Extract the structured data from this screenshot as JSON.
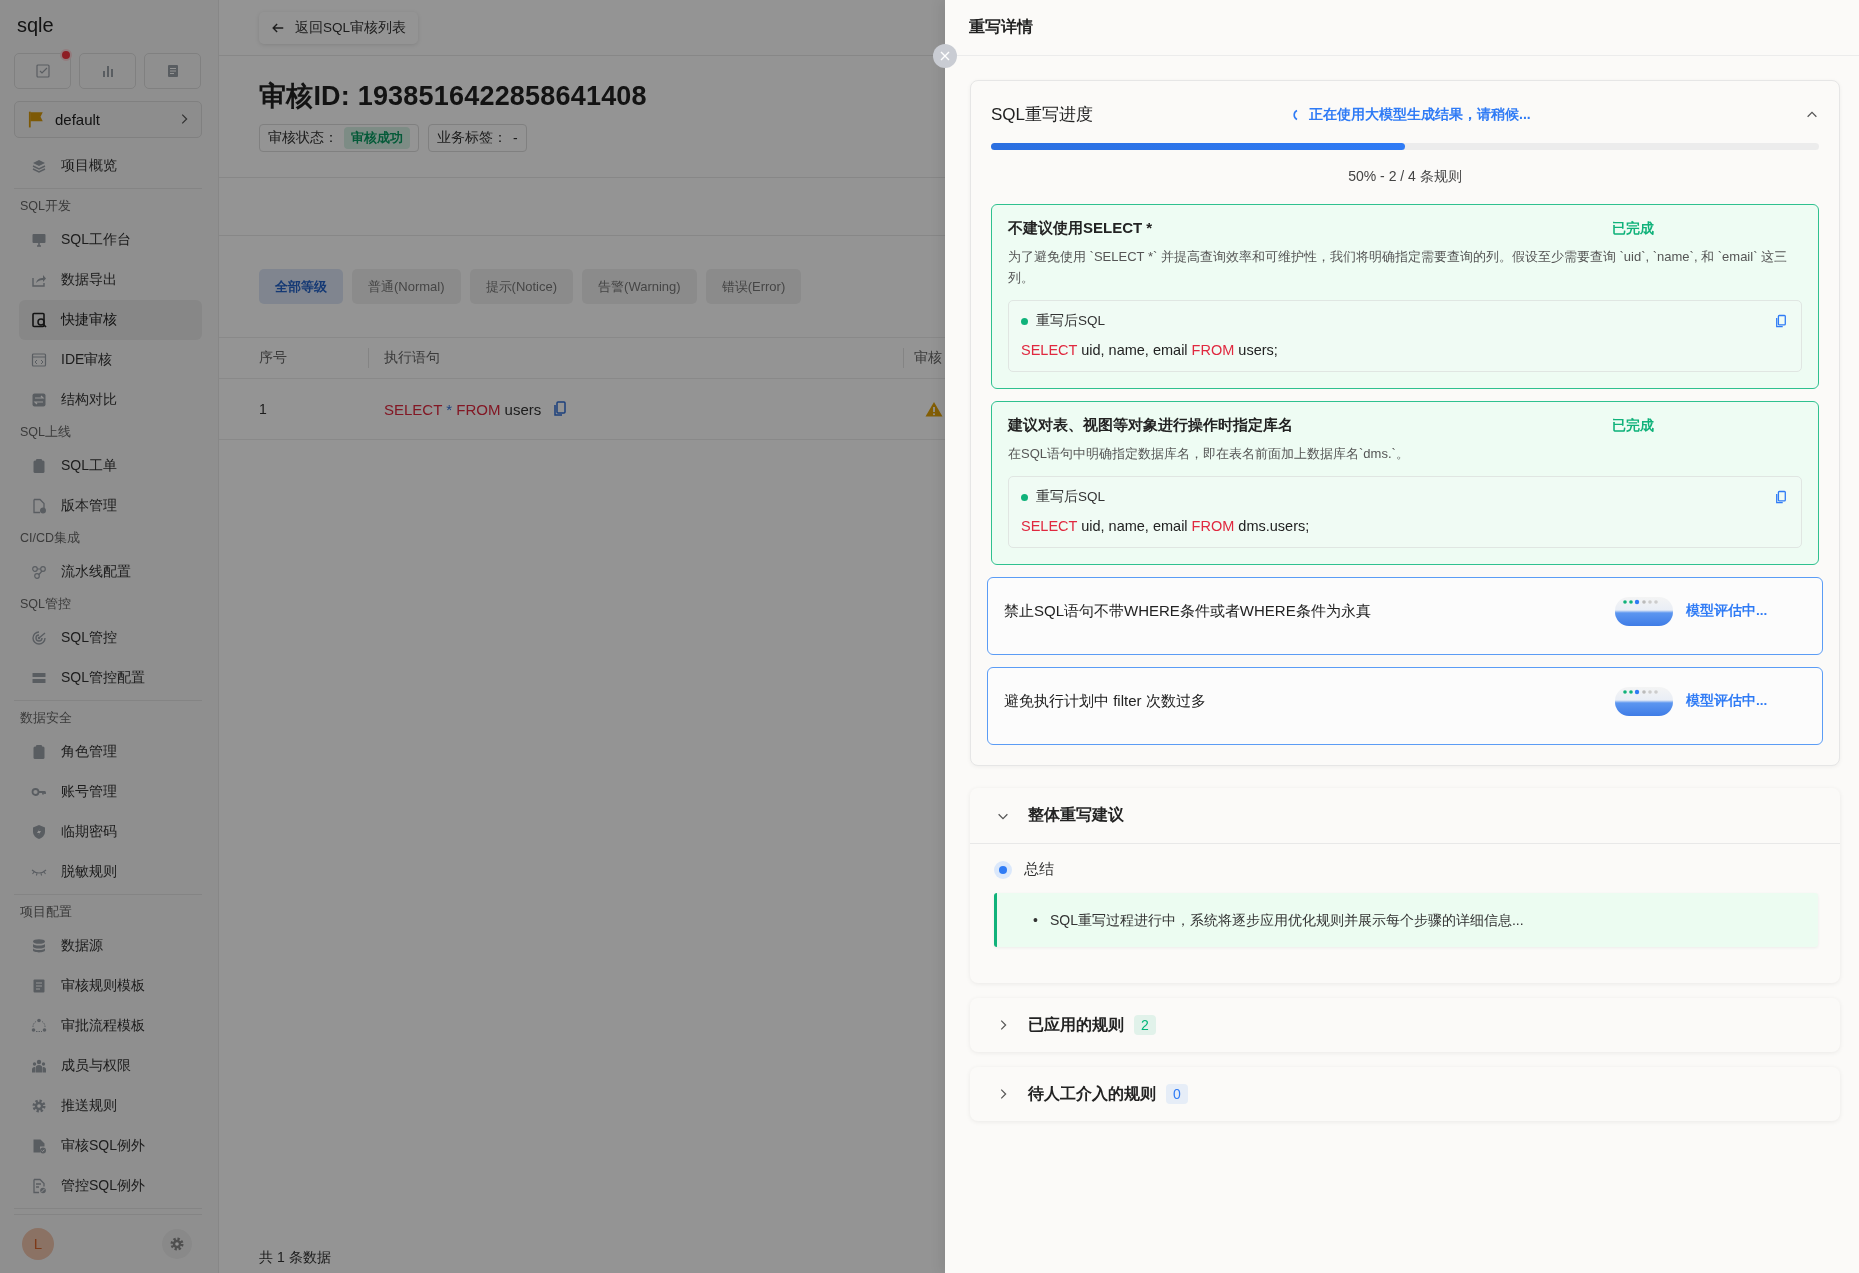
{
  "sidebar": {
    "logo": "sqle",
    "quick_actions": [
      {
        "badge": true
      },
      {
        "badge": false
      },
      {
        "badge": false
      }
    ],
    "project": "default",
    "groups": [
      {
        "items": [
          {
            "label": "项目概览",
            "selected": false
          }
        ],
        "divider_after": true
      },
      {
        "title": "SQL开发",
        "items": [
          {
            "label": "SQL工作台",
            "selected": false
          },
          {
            "label": "数据导出",
            "selected": false
          },
          {
            "label": "快捷审核",
            "selected": true
          },
          {
            "label": "IDE审核",
            "selected": false
          },
          {
            "label": "结构对比",
            "selected": false
          }
        ],
        "divider_after": false
      },
      {
        "title": "SQL上线",
        "items": [
          {
            "label": "SQL工单",
            "selected": false
          },
          {
            "label": "版本管理",
            "selected": false
          }
        ],
        "divider_after": false
      },
      {
        "title": "CI/CD集成",
        "items": [
          {
            "label": "流水线配置",
            "selected": false
          }
        ],
        "divider_after": false
      },
      {
        "title": "SQL管控",
        "items": [
          {
            "label": "SQL管控",
            "selected": false
          },
          {
            "label": "SQL管控配置",
            "selected": false
          }
        ],
        "divider_after": true
      },
      {
        "title": "数据安全",
        "items": [
          {
            "label": "角色管理",
            "selected": false
          },
          {
            "label": "账号管理",
            "selected": false
          },
          {
            "label": "临期密码",
            "selected": false
          },
          {
            "label": "脱敏规则",
            "selected": false
          }
        ],
        "divider_after": true
      },
      {
        "title": "项目配置",
        "items": [
          {
            "label": "数据源",
            "selected": false
          },
          {
            "label": "审核规则模板",
            "selected": false
          },
          {
            "label": "审批流程模板",
            "selected": false
          },
          {
            "label": "成员与权限",
            "selected": false
          },
          {
            "label": "推送规则",
            "selected": false
          },
          {
            "label": "审核SQL例外",
            "selected": false
          },
          {
            "label": "管控SQL例外",
            "selected": false
          }
        ],
        "divider_after": true
      }
    ],
    "user": {
      "avatar": "L"
    }
  },
  "main": {
    "back_button": "返回SQL审核列表",
    "title": "审核ID: 1938516422858641408",
    "status_label": "审核状态：",
    "status_tag": "审核成功",
    "business_label": "业务标签：",
    "business_value": "-",
    "filters": [
      {
        "label": "全部等级",
        "selected": true
      },
      {
        "label": "普通(Normal)",
        "selected": false
      },
      {
        "label": "提示(Notice)",
        "selected": false
      },
      {
        "label": "告警(Warning)",
        "selected": false
      },
      {
        "label": "错误(Error)",
        "selected": false
      }
    ],
    "table": {
      "columns": [
        "序号",
        "执行语句",
        "审核"
      ],
      "rows": [
        {
          "index": "1",
          "sql": [
            {
              "text": "SELECT",
              "kind": "keyword"
            },
            {
              "text": " * ",
              "kind": "operator"
            },
            {
              "text": "FROM",
              "kind": "keyword"
            },
            {
              "text": " users",
              "kind": "plain"
            }
          ]
        }
      ]
    },
    "footer": "共 1 条数据"
  },
  "drawer": {
    "title": "重写详情",
    "progress": {
      "title": "SQL重写进度",
      "status": "正在使用大模型生成结果，请稍候...",
      "expanded": true,
      "level": 0.5,
      "text": "50% - 2 / 4 条规则",
      "rules": [
        {
          "kind": "done",
          "title": "不建议使用SELECT *",
          "status": "已完成",
          "description": "为了避免使用 `SELECT *` 并提高查询效率和可维护性，我们将明确指定需要查询的列。假设至少需要查询 `uid`, `name`, 和 `email` 这三列。",
          "sql_label": "重写后SQL",
          "sql": [
            {
              "text": "SELECT",
              "kind": "keyword"
            },
            {
              "text": " uid, name, email ",
              "kind": "plain"
            },
            {
              "text": "FROM",
              "kind": "keyword"
            },
            {
              "text": " users;",
              "kind": "plain"
            }
          ]
        },
        {
          "kind": "done",
          "title": "建议对表、视图等对象进行操作时指定库名",
          "status": "已完成",
          "description": "在SQL语句中明确指定数据库名，即在表名前面加上数据库名`dms.`。",
          "sql_label": "重写后SQL",
          "sql": [
            {
              "text": "SELECT",
              "kind": "keyword"
            },
            {
              "text": " uid, name, email ",
              "kind": "plain"
            },
            {
              "text": "FROM",
              "kind": "keyword"
            },
            {
              "text": " dms.users;",
              "kind": "plain"
            }
          ]
        },
        {
          "kind": "evaluating",
          "title": "禁止SQL语句不带WHERE条件或者WHERE条件为永真",
          "status": "模型评估中..."
        },
        {
          "kind": "evaluating",
          "title": "避免执行计划中 filter 次数过多",
          "status": "模型评估中..."
        }
      ]
    },
    "summary": {
      "title": "整体重写建议",
      "expanded": true,
      "section": "总结",
      "bullets": [
        {
          "marker": "•",
          "text": "SQL重写过程进行中，系统将逐步应用优化规则并展示每个步骤的详细信息..."
        }
      ]
    },
    "panels": [
      {
        "title": "已应用的规则",
        "count": "2",
        "color": "#00b578",
        "expanded": false
      },
      {
        "title": "待人工介入的规则",
        "count": "0",
        "color": "#2f7bf5",
        "expanded": false
      }
    ]
  }
}
